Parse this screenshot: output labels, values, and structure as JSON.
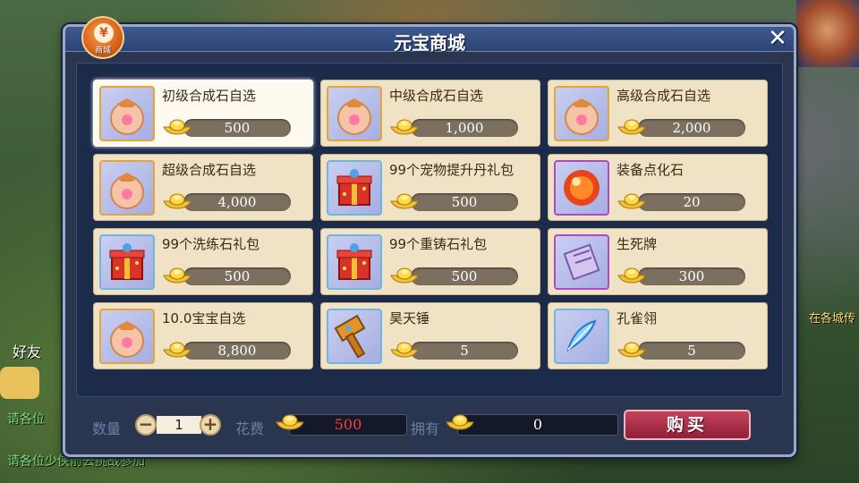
{
  "background": {
    "friend_label": "好友",
    "chat_line_1": "请各位",
    "chat_line_2": "请各位少侠前去挑战参加",
    "right_text": "在各城传"
  },
  "shop": {
    "badge_glyph": "¥",
    "badge_label": "商城",
    "title": "元宝商城",
    "close_label": "✕",
    "items": [
      {
        "name": "初级合成石自选",
        "price": "500",
        "icon": "bag-icon",
        "frame": "gold",
        "selected": true
      },
      {
        "name": "中级合成石自选",
        "price": "1,000",
        "icon": "bag-icon",
        "frame": "gold"
      },
      {
        "name": "高级合成石自选",
        "price": "2,000",
        "icon": "bag-icon",
        "frame": "gold"
      },
      {
        "name": "超级合成石自选",
        "price": "4,000",
        "icon": "bag-icon",
        "frame": "gold"
      },
      {
        "name": "99个宠物提升丹礼包",
        "price": "500",
        "icon": "gift-box-icon",
        "frame": "blue"
      },
      {
        "name": "装备点化石",
        "price": "20",
        "icon": "red-orb-icon",
        "frame": "purple"
      },
      {
        "name": "99个洗练石礼包",
        "price": "500",
        "icon": "gift-box-icon",
        "frame": "blue"
      },
      {
        "name": "99个重铸石礼包",
        "price": "500",
        "icon": "gift-box-icon",
        "frame": "blue"
      },
      {
        "name": "生死牌",
        "price": "300",
        "icon": "scroll-icon",
        "frame": "purple"
      },
      {
        "name": "10.0宝宝自选",
        "price": "8,800",
        "icon": "bag-icon",
        "frame": "gold"
      },
      {
        "name": "昊天锤",
        "price": "5",
        "icon": "hammer-icon",
        "frame": "blue"
      },
      {
        "name": "孔雀翎",
        "price": "5",
        "icon": "feather-icon",
        "frame": "blue"
      }
    ],
    "footer": {
      "qty_label": "数量",
      "qty_minus": "−",
      "qty_value": "1",
      "qty_plus": "+",
      "cost_label": "花费",
      "cost_value": "500",
      "own_label": "拥有",
      "own_value": "0",
      "buy_label": "购买"
    },
    "colors": {
      "panel_bg": "#2a3550",
      "item_bg": "#f0e2c4",
      "cost_red": "#ff3a3a",
      "buy_button": "#b0304a"
    }
  }
}
